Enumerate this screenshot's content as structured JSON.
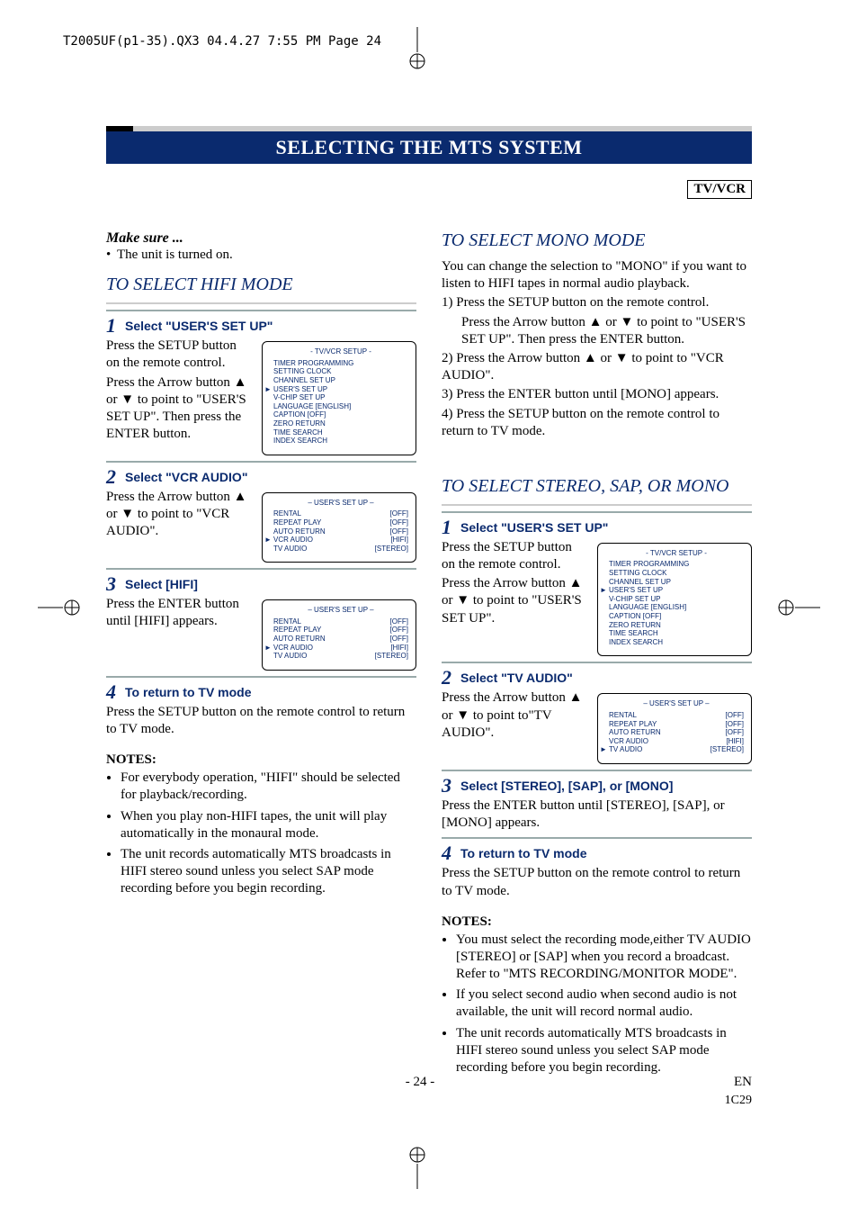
{
  "header": {
    "print_info": "T2005UF(p1-35).QX3  04.4.27  7:55 PM  Page 24"
  },
  "title": "SELECTING THE MTS SYSTEM",
  "tag": "TV/VCR",
  "makesure_label": "Make sure ...",
  "makesure_item": "The unit is turned on.",
  "left": {
    "heading": "TO SELECT HIFI MODE",
    "step1": {
      "num": "1",
      "label": "Select \"USER'S SET UP\"",
      "line1": "Press the SETUP button on the remote control.",
      "line2": "Press the Arrow button ▲ or ▼ to point to \"USER'S SET UP\". Then press the ENTER button."
    },
    "step2": {
      "num": "2",
      "label": "Select \"VCR AUDIO\"",
      "line1": "Press the Arrow button ▲ or ▼ to point to \"VCR AUDIO\"."
    },
    "step3": {
      "num": "3",
      "label": "Select [HIFI]",
      "line1": "Press the ENTER button until [HIFI] appears."
    },
    "step4": {
      "num": "4",
      "label": "To return to TV mode",
      "line1": "Press the SETUP button on the remote control to return to TV mode."
    },
    "notes_h": "NOTES:",
    "notes": [
      "For everybody operation, \"HIFI\" should be selected for playback/recording.",
      "When you play non-HIFI tapes, the unit will play automatically in the monaural mode.",
      "The unit records automatically MTS broadcasts in HIFI stereo sound unless you select SAP mode recording before you begin recording."
    ]
  },
  "right": {
    "heading1": "TO SELECT MONO MODE",
    "mono_intro": "You can change the selection to \"MONO\" if you want to listen to HIFI tapes in normal audio playback.",
    "mono_1a": "1) Press the SETUP button on the remote control.",
    "mono_1b": "Press the Arrow button ▲ or ▼ to point to \"USER'S SET UP\". Then press the ENTER button.",
    "mono_2": "2) Press the Arrow button ▲ or ▼ to point to \"VCR AUDIO\".",
    "mono_3": "3) Press the ENTER button until [MONO] appears.",
    "mono_4": "4) Press the SETUP button on the remote control to return to TV mode.",
    "heading2": "TO SELECT STEREO, SAP, OR MONO",
    "step1": {
      "num": "1",
      "label": "Select \"USER'S SET UP\"",
      "line1": "Press the SETUP button on the remote control.",
      "line2": "Press the Arrow button ▲ or ▼ to point to \"USER'S SET UP\"."
    },
    "step2": {
      "num": "2",
      "label": "Select \"TV AUDIO\"",
      "line1": "Press the Arrow button ▲ or ▼ to point to\"TV AUDIO\"."
    },
    "step3": {
      "num": "3",
      "label": "Select [STEREO], [SAP], or [MONO]",
      "line1": "Press the ENTER button until [STEREO], [SAP], or [MONO] appears."
    },
    "step4": {
      "num": "4",
      "label": "To return to TV mode",
      "line1": "Press the SETUP button on the remote control to return to TV mode."
    },
    "notes_h": "NOTES:",
    "notes": [
      "You must select the recording mode,either TV AUDIO [STEREO] or [SAP] when you record a broadcast.\nRefer to \"MTS RECORDING/MONITOR MODE\".",
      "If you select second audio when second audio is not available, the unit will record normal audio.",
      "The unit records automatically MTS broadcasts in HIFI stereo sound unless you select SAP mode recording before you begin recording."
    ]
  },
  "osd_setup": {
    "title": "- TV/VCR SETUP -",
    "items": [
      "TIMER PROGRAMMING",
      "SETTING CLOCK",
      "CHANNEL SET UP",
      "USER'S SET UP",
      "V-CHIP SET UP",
      "LANGUAGE  [ENGLISH]",
      "CAPTION  [OFF]",
      "ZERO RETURN",
      "TIME SEARCH",
      "INDEX SEARCH"
    ],
    "pointer_index": 3
  },
  "osd_user_vcr": {
    "title": "– USER'S SET UP –",
    "rows": [
      {
        "l": "RENTAL",
        "r": "[OFF]"
      },
      {
        "l": "REPEAT PLAY",
        "r": "[OFF]"
      },
      {
        "l": "AUTO RETURN",
        "r": "[OFF]"
      },
      {
        "l": "VCR AUDIO",
        "r": "[HIFI]"
      },
      {
        "l": "TV AUDIO",
        "r": "[STEREO]"
      }
    ],
    "pointer_index": 3
  },
  "osd_user_tv": {
    "title": "– USER'S SET UP –",
    "rows": [
      {
        "l": "RENTAL",
        "r": "[OFF]"
      },
      {
        "l": "REPEAT PLAY",
        "r": "[OFF]"
      },
      {
        "l": "AUTO RETURN",
        "r": "[OFF]"
      },
      {
        "l": "VCR AUDIO",
        "r": "[HIFI]"
      },
      {
        "l": "TV AUDIO",
        "r": "[STEREO]"
      }
    ],
    "pointer_index": 4
  },
  "footer": {
    "page": "- 24 -",
    "lang": "EN",
    "code": "1C29"
  }
}
